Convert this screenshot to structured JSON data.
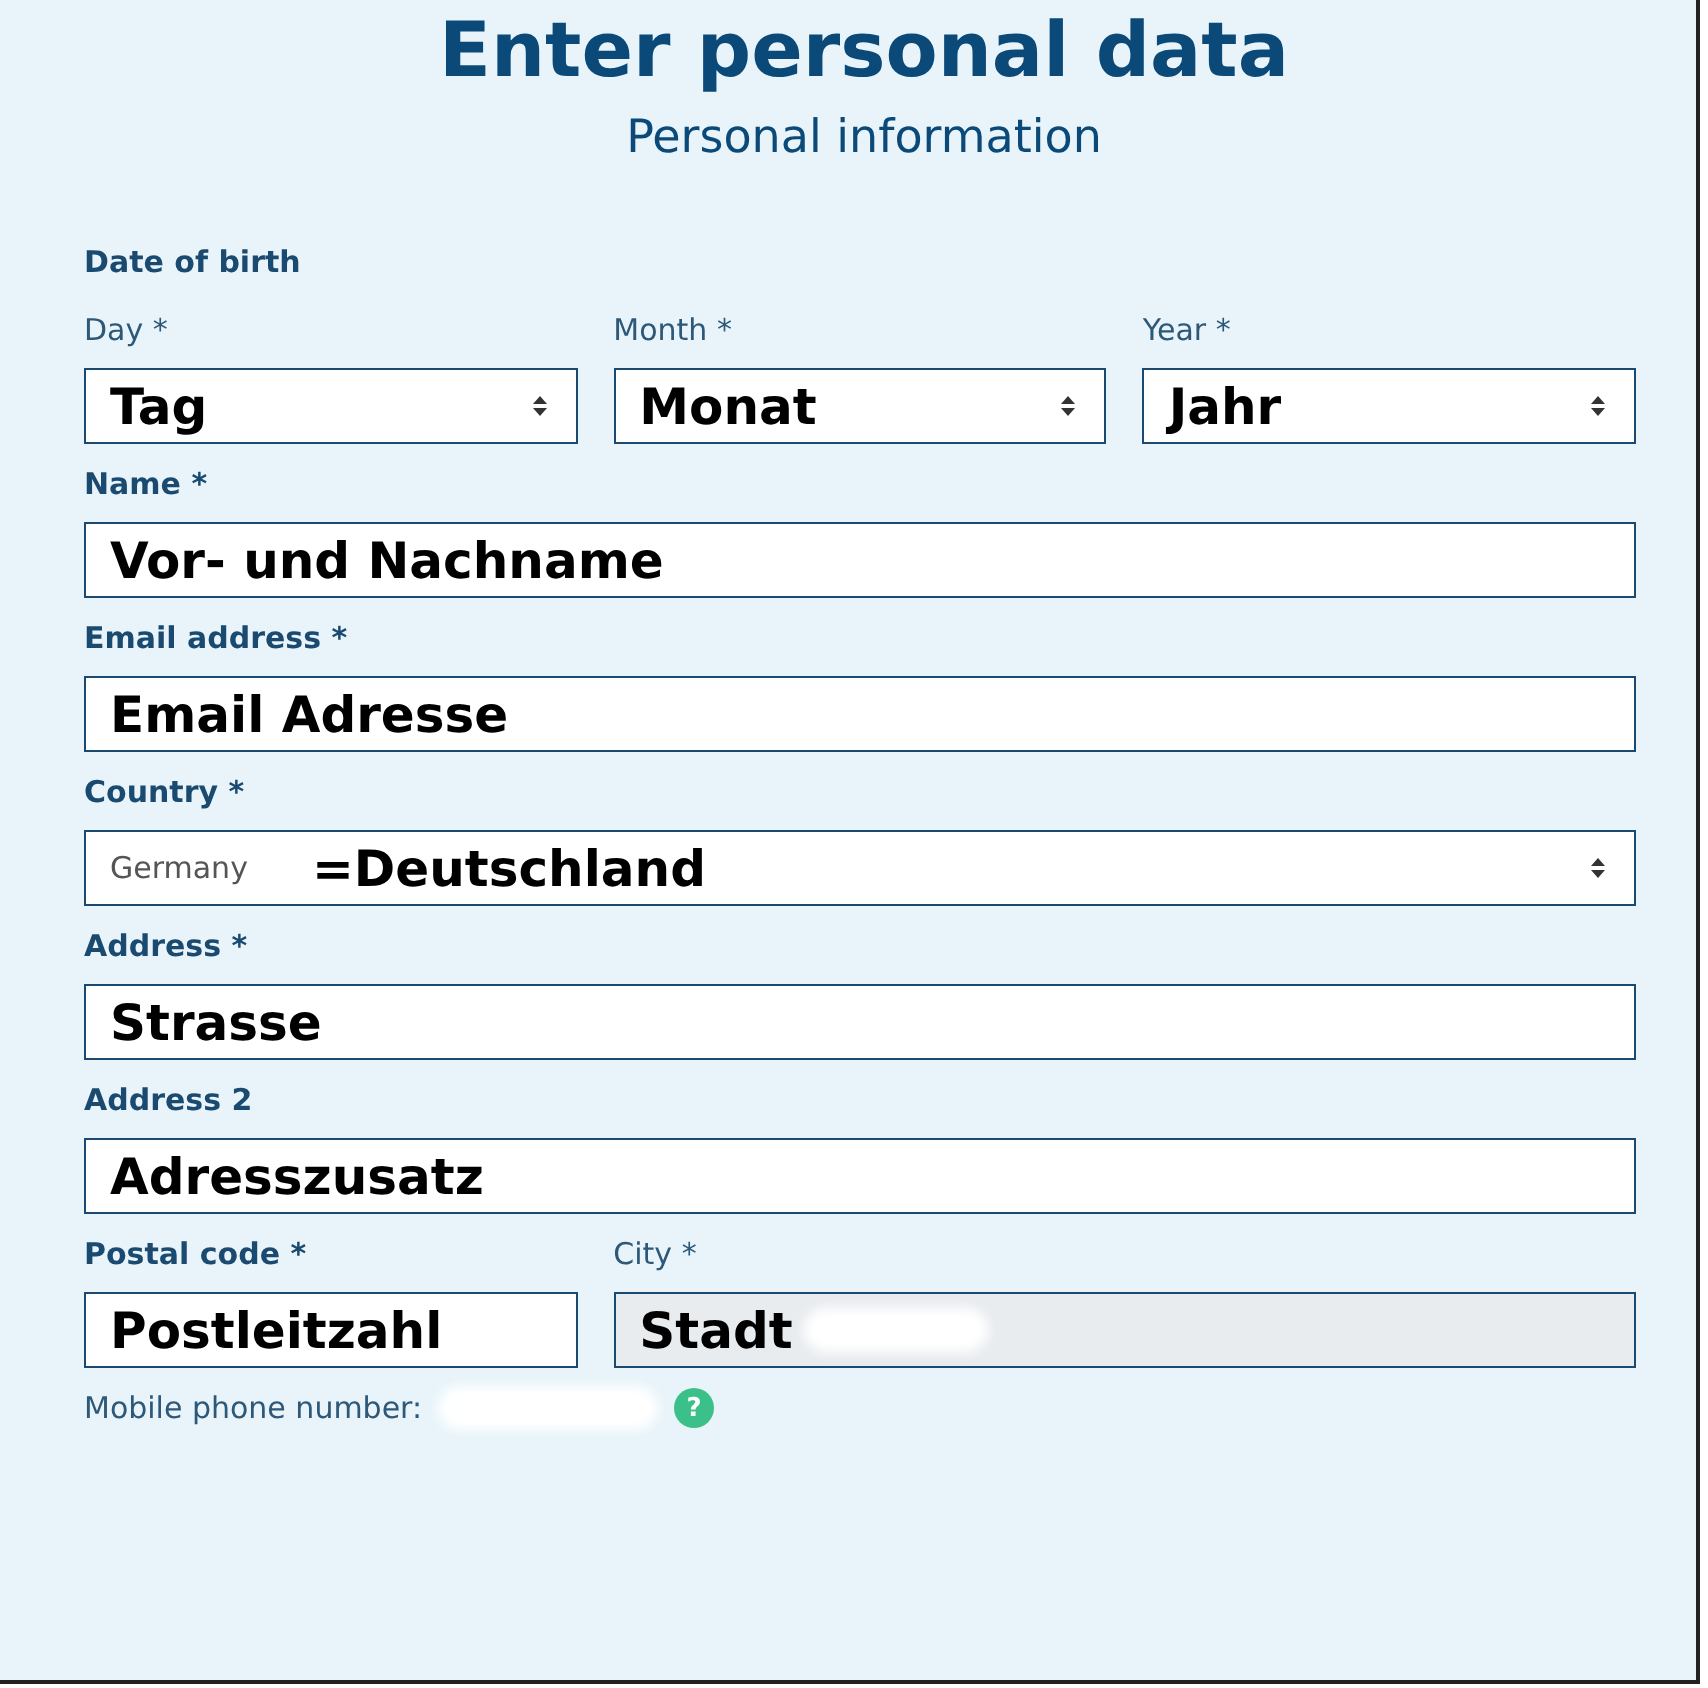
{
  "title": "Enter personal data",
  "subtitle": "Personal information",
  "groups": [
    {
      "label": "Date of birth",
      "fields": [
        {
          "label": "Day *",
          "emphasis": false,
          "kind": "select",
          "value": "Tag",
          "disabled": false
        },
        {
          "label": "Month *",
          "emphasis": false,
          "kind": "select",
          "value": "Monat",
          "disabled": false
        },
        {
          "label": "Year *",
          "emphasis": false,
          "kind": "select",
          "value": "Jahr",
          "disabled": false
        }
      ]
    },
    {
      "fields": [
        {
          "label": "Name *",
          "emphasis": true,
          "kind": "text",
          "value": "Vor- und Nachname",
          "disabled": false
        }
      ]
    },
    {
      "fields": [
        {
          "label": "Email address *",
          "emphasis": true,
          "kind": "text",
          "value": "Email Adresse",
          "disabled": false
        }
      ]
    },
    {
      "fields": [
        {
          "label": "Country *",
          "emphasis": true,
          "kind": "select",
          "prefix": "Germany",
          "value": "=Deutschland",
          "disabled": false
        }
      ]
    },
    {
      "fields": [
        {
          "label": "Address *",
          "emphasis": true,
          "kind": "text",
          "value": "Strasse",
          "disabled": false
        }
      ]
    },
    {
      "fields": [
        {
          "label": "Address 2",
          "emphasis": true,
          "kind": "text",
          "value": "Adresszusatz",
          "disabled": false
        }
      ]
    },
    {
      "fields": [
        {
          "label": "Postal code *",
          "emphasis": true,
          "kind": "text",
          "value": "Postleitzahl",
          "disabled": false
        },
        {
          "label": "City *",
          "emphasis": false,
          "kind": "text",
          "value": "Stadt",
          "disabled": true,
          "redacted": true
        }
      ]
    }
  ],
  "phone": {
    "label": "Mobile phone number:",
    "redacted": true,
    "help": "?"
  }
}
